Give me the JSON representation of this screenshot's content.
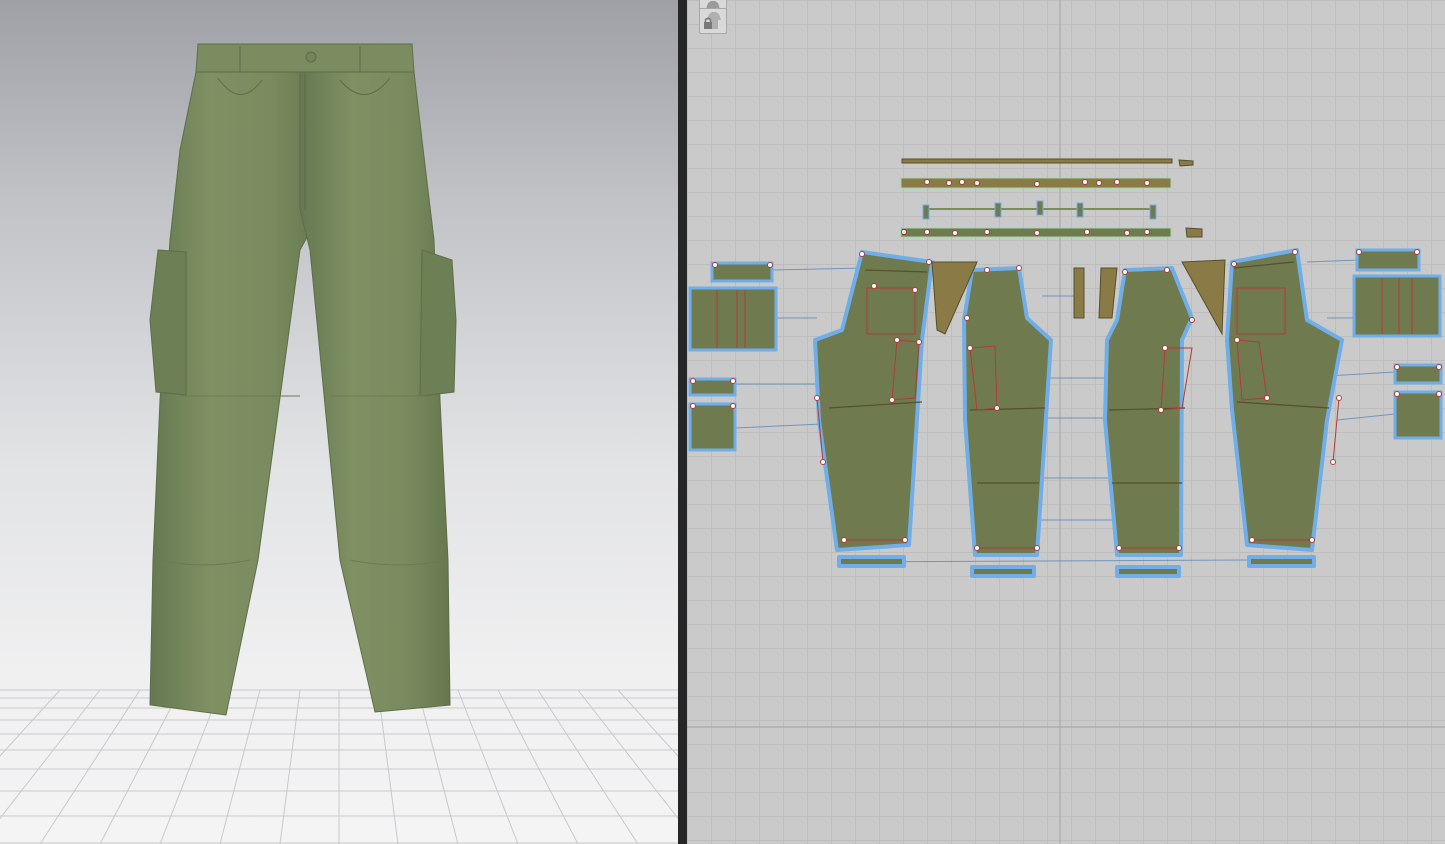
{
  "app": {
    "left_panel": "3d-garment-view",
    "right_panel": "2d-pattern-view"
  },
  "garment": {
    "type": "cargo pants",
    "fabric_color": "#7a8b5e",
    "pattern_fill": "#6f7a4e",
    "trim_color": "#8a7a45",
    "selection_outline": "#6faee8",
    "seam_line_color": "#b33a3a"
  },
  "toolbar_2d": {
    "icons": [
      "garment-icon",
      "lock-garment-icon"
    ]
  }
}
